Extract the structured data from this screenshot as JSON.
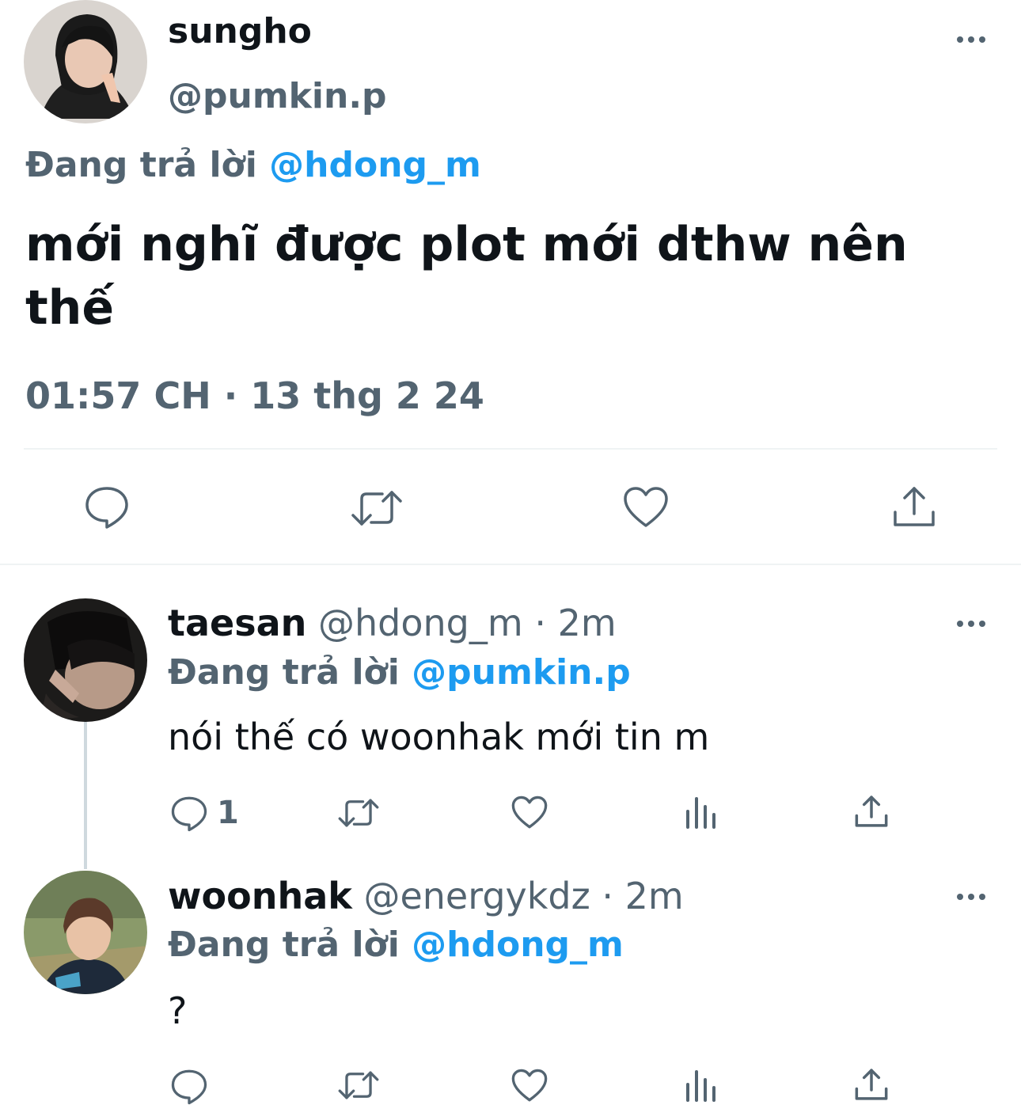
{
  "main_tweet": {
    "display_name": "sungho",
    "handle": "@pumkin.p",
    "reply_prefix": "Đang trả lời",
    "reply_to": "@hdong_m",
    "text_line1": "mới nghĩ được plot mới dthw nên",
    "text_line2": "thế",
    "timestamp": "01:57 CH · 13 thg 2 24"
  },
  "replies": [
    {
      "display_name": "taesan",
      "handle": "@hdong_m",
      "separator": "·",
      "time": "2m",
      "reply_prefix": "Đang trả lời",
      "reply_to": "@pumkin.p",
      "text": "nói thế có woonhak mới tin m",
      "reply_count": "1"
    },
    {
      "display_name": "woonhak",
      "handle": "@energykdz",
      "separator": "·",
      "time": "2m",
      "reply_prefix": "Đang trả lời",
      "reply_to": "@hdong_m",
      "text": "?",
      "reply_count": ""
    }
  ],
  "icons": {
    "more": "more-horizontal-icon",
    "reply": "comment-bubble-icon",
    "retweet": "retweet-arrows-icon",
    "like": "heart-outline-icon",
    "views": "bar-chart-icon",
    "share": "share-upload-icon"
  },
  "colors": {
    "text": "#0f1419",
    "secondary": "#536471",
    "link": "#1d9bf0",
    "divider": "#eff3f4",
    "thread_line": "#cfd9de"
  }
}
